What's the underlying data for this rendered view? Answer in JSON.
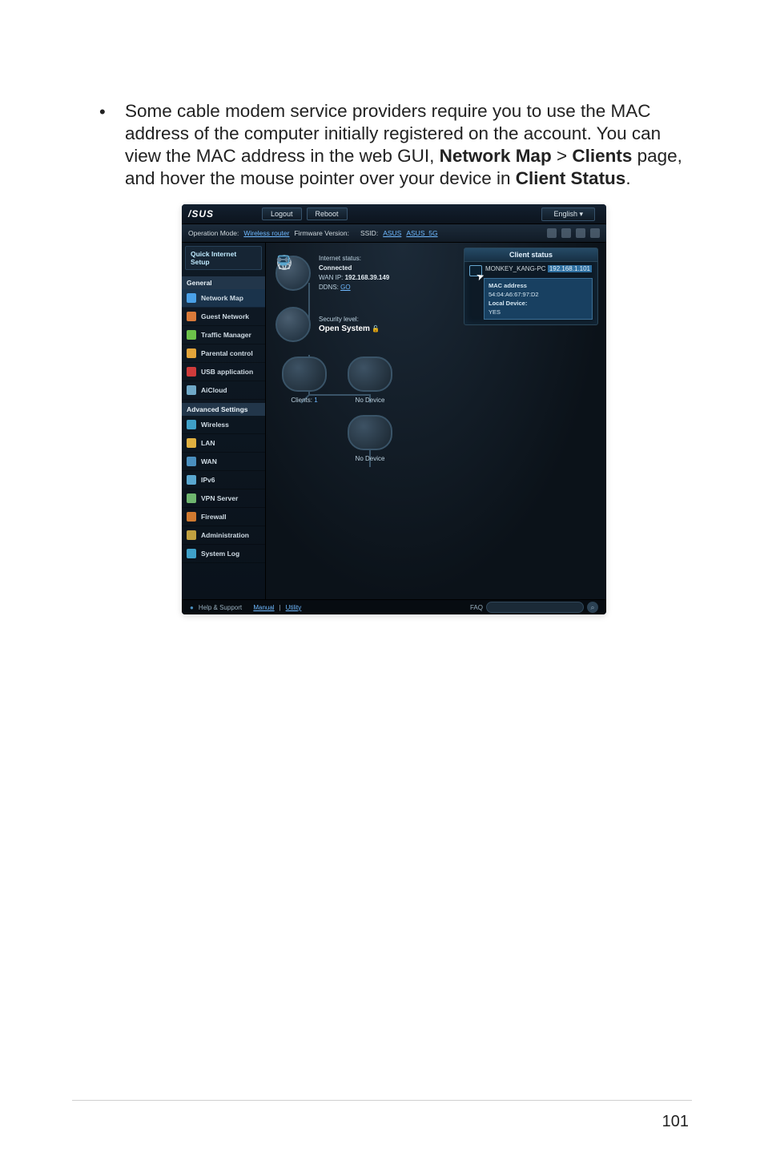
{
  "page": {
    "bullet": "•",
    "text_parts": {
      "p1": "Some cable modem service providers require you to use the MAC address of the computer initially registered on the account. You can view the MAC address in the web GUI, ",
      "b1": "Network Map",
      "gt": " > ",
      "b2": "Clients",
      "p2": " page, and hover the mouse pointer over your device in ",
      "b3": "Client Status",
      "p3": "."
    },
    "number": "101"
  },
  "ui": {
    "brand": "/SUS",
    "topbar": {
      "logout": "Logout",
      "reboot": "Reboot",
      "english": "English"
    },
    "infobar": {
      "op_mode_label": "Operation Mode:",
      "op_mode_value": "Wireless router",
      "fw_label": "Firmware Version:",
      "ssid_label": "SSID:",
      "ssid1": "ASUS",
      "ssid2": "ASUS_5G"
    },
    "sidebar": {
      "quick": "Quick Internet\nSetup",
      "general": "General",
      "items_general": [
        {
          "label": "Network Map",
          "color": "#4aa1e8"
        },
        {
          "label": "Guest Network",
          "color": "#d97a3a"
        },
        {
          "label": "Traffic Manager",
          "color": "#6cc24a"
        },
        {
          "label": "Parental control",
          "color": "#e2a43a"
        },
        {
          "label": "USB application",
          "color": "#cf3b3b"
        },
        {
          "label": "AiCloud",
          "color": "#6fa8c7"
        }
      ],
      "advanced": "Advanced Settings",
      "items_adv": [
        {
          "label": "Wireless",
          "color": "#3fa0c8"
        },
        {
          "label": "LAN",
          "color": "#e0b040"
        },
        {
          "label": "WAN",
          "color": "#4a8fbf"
        },
        {
          "label": "IPv6",
          "color": "#5aa7cf"
        },
        {
          "label": "VPN Server",
          "color": "#6fb66f"
        },
        {
          "label": "Firewall",
          "color": "#d07a30"
        },
        {
          "label": "Administration",
          "color": "#c0a040"
        },
        {
          "label": "System Log",
          "color": "#3fa0c8"
        }
      ]
    },
    "content": {
      "internet_status_label": "Internet status:",
      "internet_status_value": "Connected",
      "wan_ip_label": "WAN IP:",
      "wan_ip_value": "192.168.39.149",
      "ddns_label": "DDNS:",
      "ddns_value": "GO",
      "security_label": "Security level:",
      "security_value": "Open System",
      "clients_label": "Clients:",
      "clients_value": "1",
      "no_device": "No Device"
    },
    "client_status": {
      "header": "Client status",
      "name": "MONKEY_KANG-PC",
      "ip": "192.168.1.101",
      "mac_label": "MAC address",
      "mac_value": "54:04:A6:67:97:D2",
      "local_label": "Local Device:",
      "local_value": "YES"
    },
    "footer": {
      "help": "Help & Support",
      "manual": "Manual",
      "utility": "Utility",
      "faq": "FAQ"
    }
  }
}
